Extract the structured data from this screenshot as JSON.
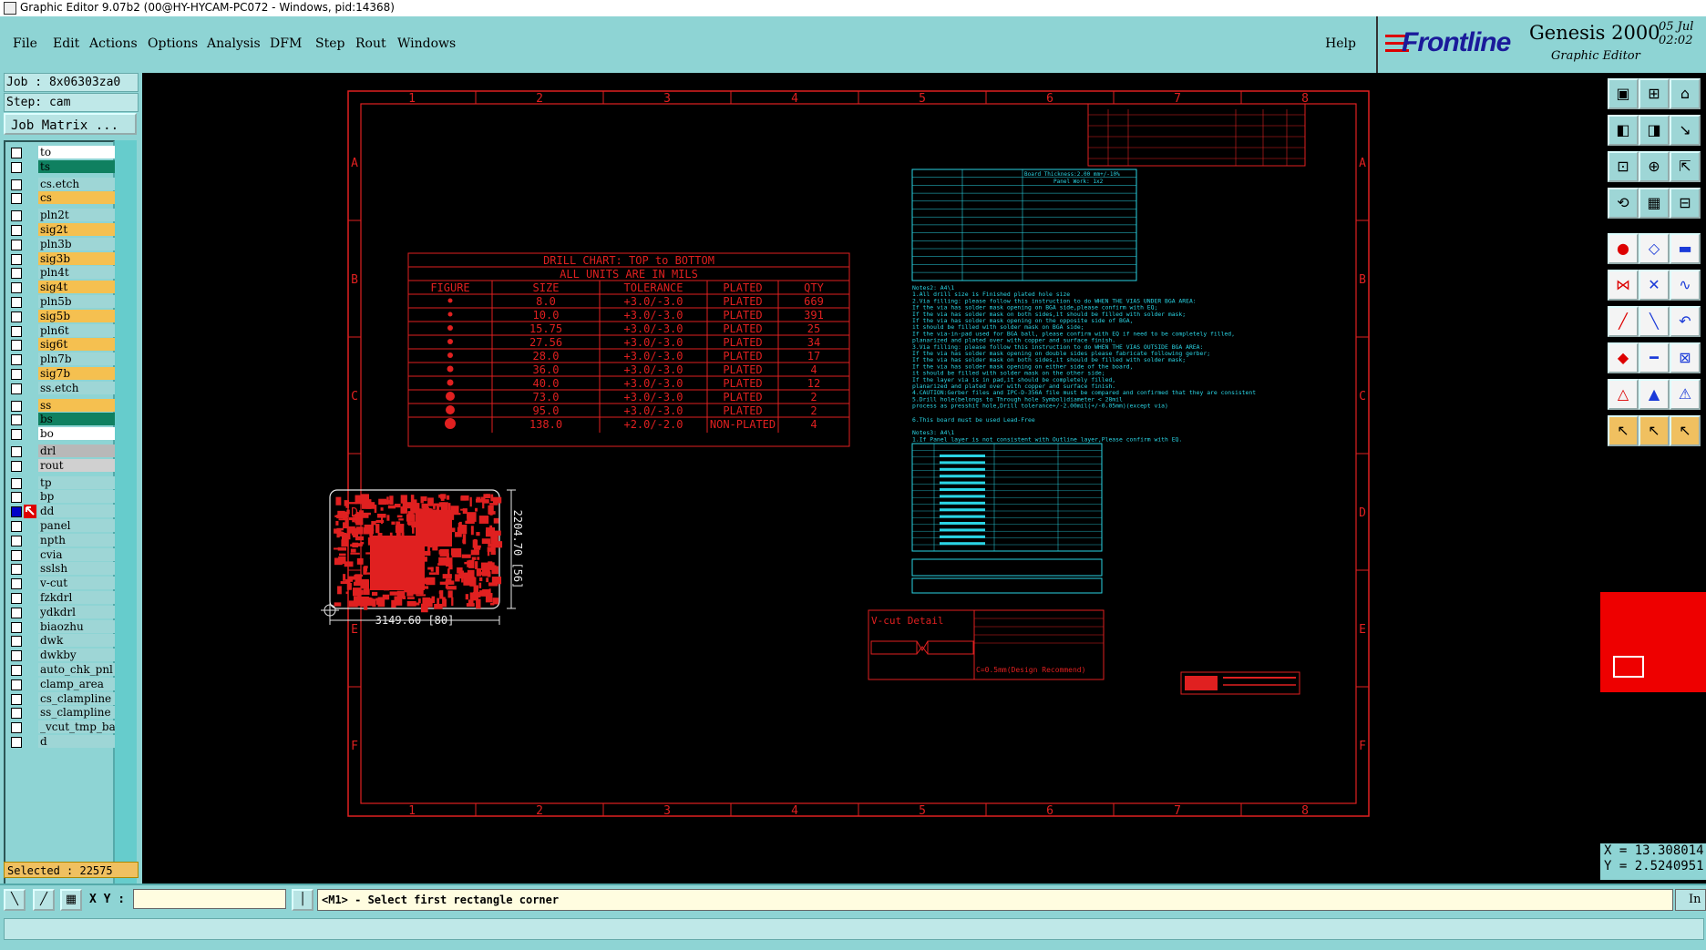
{
  "window": {
    "title": "Graphic Editor 9.07b2 (00@HY-HYCAM-PC072 - Windows, pid:14368)"
  },
  "menu": {
    "items": [
      "File",
      "Edit",
      "Actions",
      "Options",
      "Analysis",
      "DFM",
      "Step",
      "Rout",
      "Windows"
    ],
    "help": "Help"
  },
  "logo": {
    "brand": "Frontline",
    "product": "Genesis 2000",
    "subtitle": "Graphic Editor",
    "date": "05 Jul",
    "time": "02:02"
  },
  "job": {
    "job_line": "Job : 8x06303za0",
    "step_line": "Step: cam",
    "matrix_button": "Job Matrix ..."
  },
  "layers": [
    {
      "name": "to",
      "color": "#ffffff"
    },
    {
      "name": "ts",
      "color": "#0f8060"
    },
    {
      "name": "cs.etch",
      "color": "#9ed6d6"
    },
    {
      "name": "cs",
      "color": "#f5c050"
    },
    {
      "name": "pln2t",
      "color": "#9ed6d6"
    },
    {
      "name": "sig2t",
      "color": "#f5c050"
    },
    {
      "name": "pln3b",
      "color": "#9ed6d6"
    },
    {
      "name": "sig3b",
      "color": "#f5c050"
    },
    {
      "name": "pln4t",
      "color": "#9ed6d6"
    },
    {
      "name": "sig4t",
      "color": "#f5c050"
    },
    {
      "name": "pln5b",
      "color": "#9ed6d6"
    },
    {
      "name": "sig5b",
      "color": "#f5c050"
    },
    {
      "name": "pln6t",
      "color": "#9ed6d6"
    },
    {
      "name": "sig6t",
      "color": "#f5c050"
    },
    {
      "name": "pln7b",
      "color": "#9ed6d6"
    },
    {
      "name": "sig7b",
      "color": "#f5c050"
    },
    {
      "name": "ss.etch",
      "color": "#9ed6d6"
    },
    {
      "name": "ss",
      "color": "#f5c050"
    },
    {
      "name": "bs",
      "color": "#0f8060"
    },
    {
      "name": "bo",
      "color": "#ffffff"
    },
    {
      "name": "drl",
      "color": "#b8b8b8"
    },
    {
      "name": "rout",
      "color": "#d0d0d0"
    },
    {
      "name": "tp",
      "color": "#9ed6d6"
    },
    {
      "name": "bp",
      "color": "#9ed6d6"
    },
    {
      "name": "dd",
      "color": "#9ed6d6",
      "active": true
    },
    {
      "name": "panel",
      "color": "#9ed6d6"
    },
    {
      "name": "npth",
      "color": "#9ed6d6"
    },
    {
      "name": "cvia",
      "color": "#9ed6d6"
    },
    {
      "name": "sslsh",
      "color": "#9ed6d6"
    },
    {
      "name": "v-cut",
      "color": "#9ed6d6"
    },
    {
      "name": "fzkdrl",
      "color": "#9ed6d6"
    },
    {
      "name": "ydkdrl",
      "color": "#9ed6d6"
    },
    {
      "name": "biaozhu",
      "color": "#9ed6d6"
    },
    {
      "name": "dwk",
      "color": "#9ed6d6"
    },
    {
      "name": "dwkby",
      "color": "#9ed6d6"
    },
    {
      "name": "auto_chk_pnl",
      "color": "#9ed6d6"
    },
    {
      "name": "clamp_area",
      "color": "#9ed6d6"
    },
    {
      "name": "cs_clampline",
      "color": "#9ed6d6"
    },
    {
      "name": "ss_clampline",
      "color": "#9ed6d6"
    },
    {
      "name": "_vcut_tmp_ba",
      "color": "#9ed6d6"
    },
    {
      "name": "d",
      "color": "#9ed6d6"
    }
  ],
  "selected": "Selected : 22575",
  "coords": {
    "x": "X = 13.308014",
    "y": "Y = 2.5240951"
  },
  "status": {
    "xy_label": "X Y :",
    "xy_value": "",
    "prompt": "<M1> - Select first rectangle corner",
    "in_button": "In"
  },
  "drawing": {
    "col_labels": [
      "1",
      "2",
      "3",
      "4",
      "5",
      "6",
      "7",
      "8"
    ],
    "row_labels": [
      "A",
      "B",
      "C",
      "D",
      "E",
      "F"
    ],
    "drill_chart": {
      "title1": "DRILL CHART: TOP to BOTTOM",
      "title2": "ALL UNITS ARE IN MILS",
      "headers": [
        "FIGURE",
        "SIZE",
        "TOLERANCE",
        "PLATED",
        "QTY"
      ],
      "rows": [
        [
          "8.0",
          "+3.0/-3.0",
          "PLATED",
          "669"
        ],
        [
          "10.0",
          "+3.0/-3.0",
          "PLATED",
          "391"
        ],
        [
          "15.75",
          "+3.0/-3.0",
          "PLATED",
          "25"
        ],
        [
          "27.56",
          "+3.0/-3.0",
          "PLATED",
          "34"
        ],
        [
          "28.0",
          "+3.0/-3.0",
          "PLATED",
          "17"
        ],
        [
          "36.0",
          "+3.0/-3.0",
          "PLATED",
          "4"
        ],
        [
          "40.0",
          "+3.0/-3.0",
          "PLATED",
          "12"
        ],
        [
          "73.0",
          "+3.0/-3.0",
          "PLATED",
          "2"
        ],
        [
          "95.0",
          "+3.0/-3.0",
          "PLATED",
          "2"
        ],
        [
          "138.0",
          "+2.0/-2.0",
          "NON-PLATED",
          "4"
        ]
      ]
    },
    "dim_width": "3149.60 [80]",
    "dim_height": "2204.70 [56]",
    "vcut_title": "V-cut Detail",
    "vcut_note": "C=0.5mm(Design Recommend)",
    "board_thickness": "Board Thickness:2.00 mm+/-10%",
    "pnl_work": "Panel Work: 1x2",
    "notes": [
      "Notes2: A4\\1",
      "1.All drill size is Finished plated hole size",
      "2.Via filling: please follow this instruction to do WHEN THE VIAS UNDER BGA AREA:",
      "   If the via has solder mask opening on BGA side,please confirm with EQ;",
      "   If the via has solder mask on both sides,it should be filled with solder mask;",
      "   If the via has solder mask opening on the opposite side of BGA,",
      "     it should be filled with solder mask on BGA side;",
      "   If the via-in-pad used for BGA ball, please confirm with EQ if need to be completely filled,",
      "     planarized and plated over with copper and surface finish.",
      "3.Via filling: please follow this instruction to do WHEN THE VIAS OUTSIDE BGA AREA:",
      "   If the via has solder mask opening on double sides please fabricate following gerber;",
      "   If the via has solder mask on both sides,it should be filled with solder mask;",
      "   If the via has solder mask opening on either side of the board,",
      "     it should be filled with solder mask on the other side;",
      "   If the layer via is in pad,it should be completely filled,",
      "     planarized and plated over with copper and surface finish.",
      "4.CAUTION:Gerber files and IPC-D-356A file must be compared and confirmed that they are consistent",
      "5.Drill hole(belongs to Through hole Symbol)diameter < 28mil",
      "  process as presshit hole,Drill tolerance+/-2.00mil(+/-0.05mm)(except via)",
      "6.This board must be used Lead-Free",
      "",
      "Notes3: A4\\1",
      "1.If Panel layer is not consistent with Outline layer,Please confirm with EQ."
    ]
  }
}
